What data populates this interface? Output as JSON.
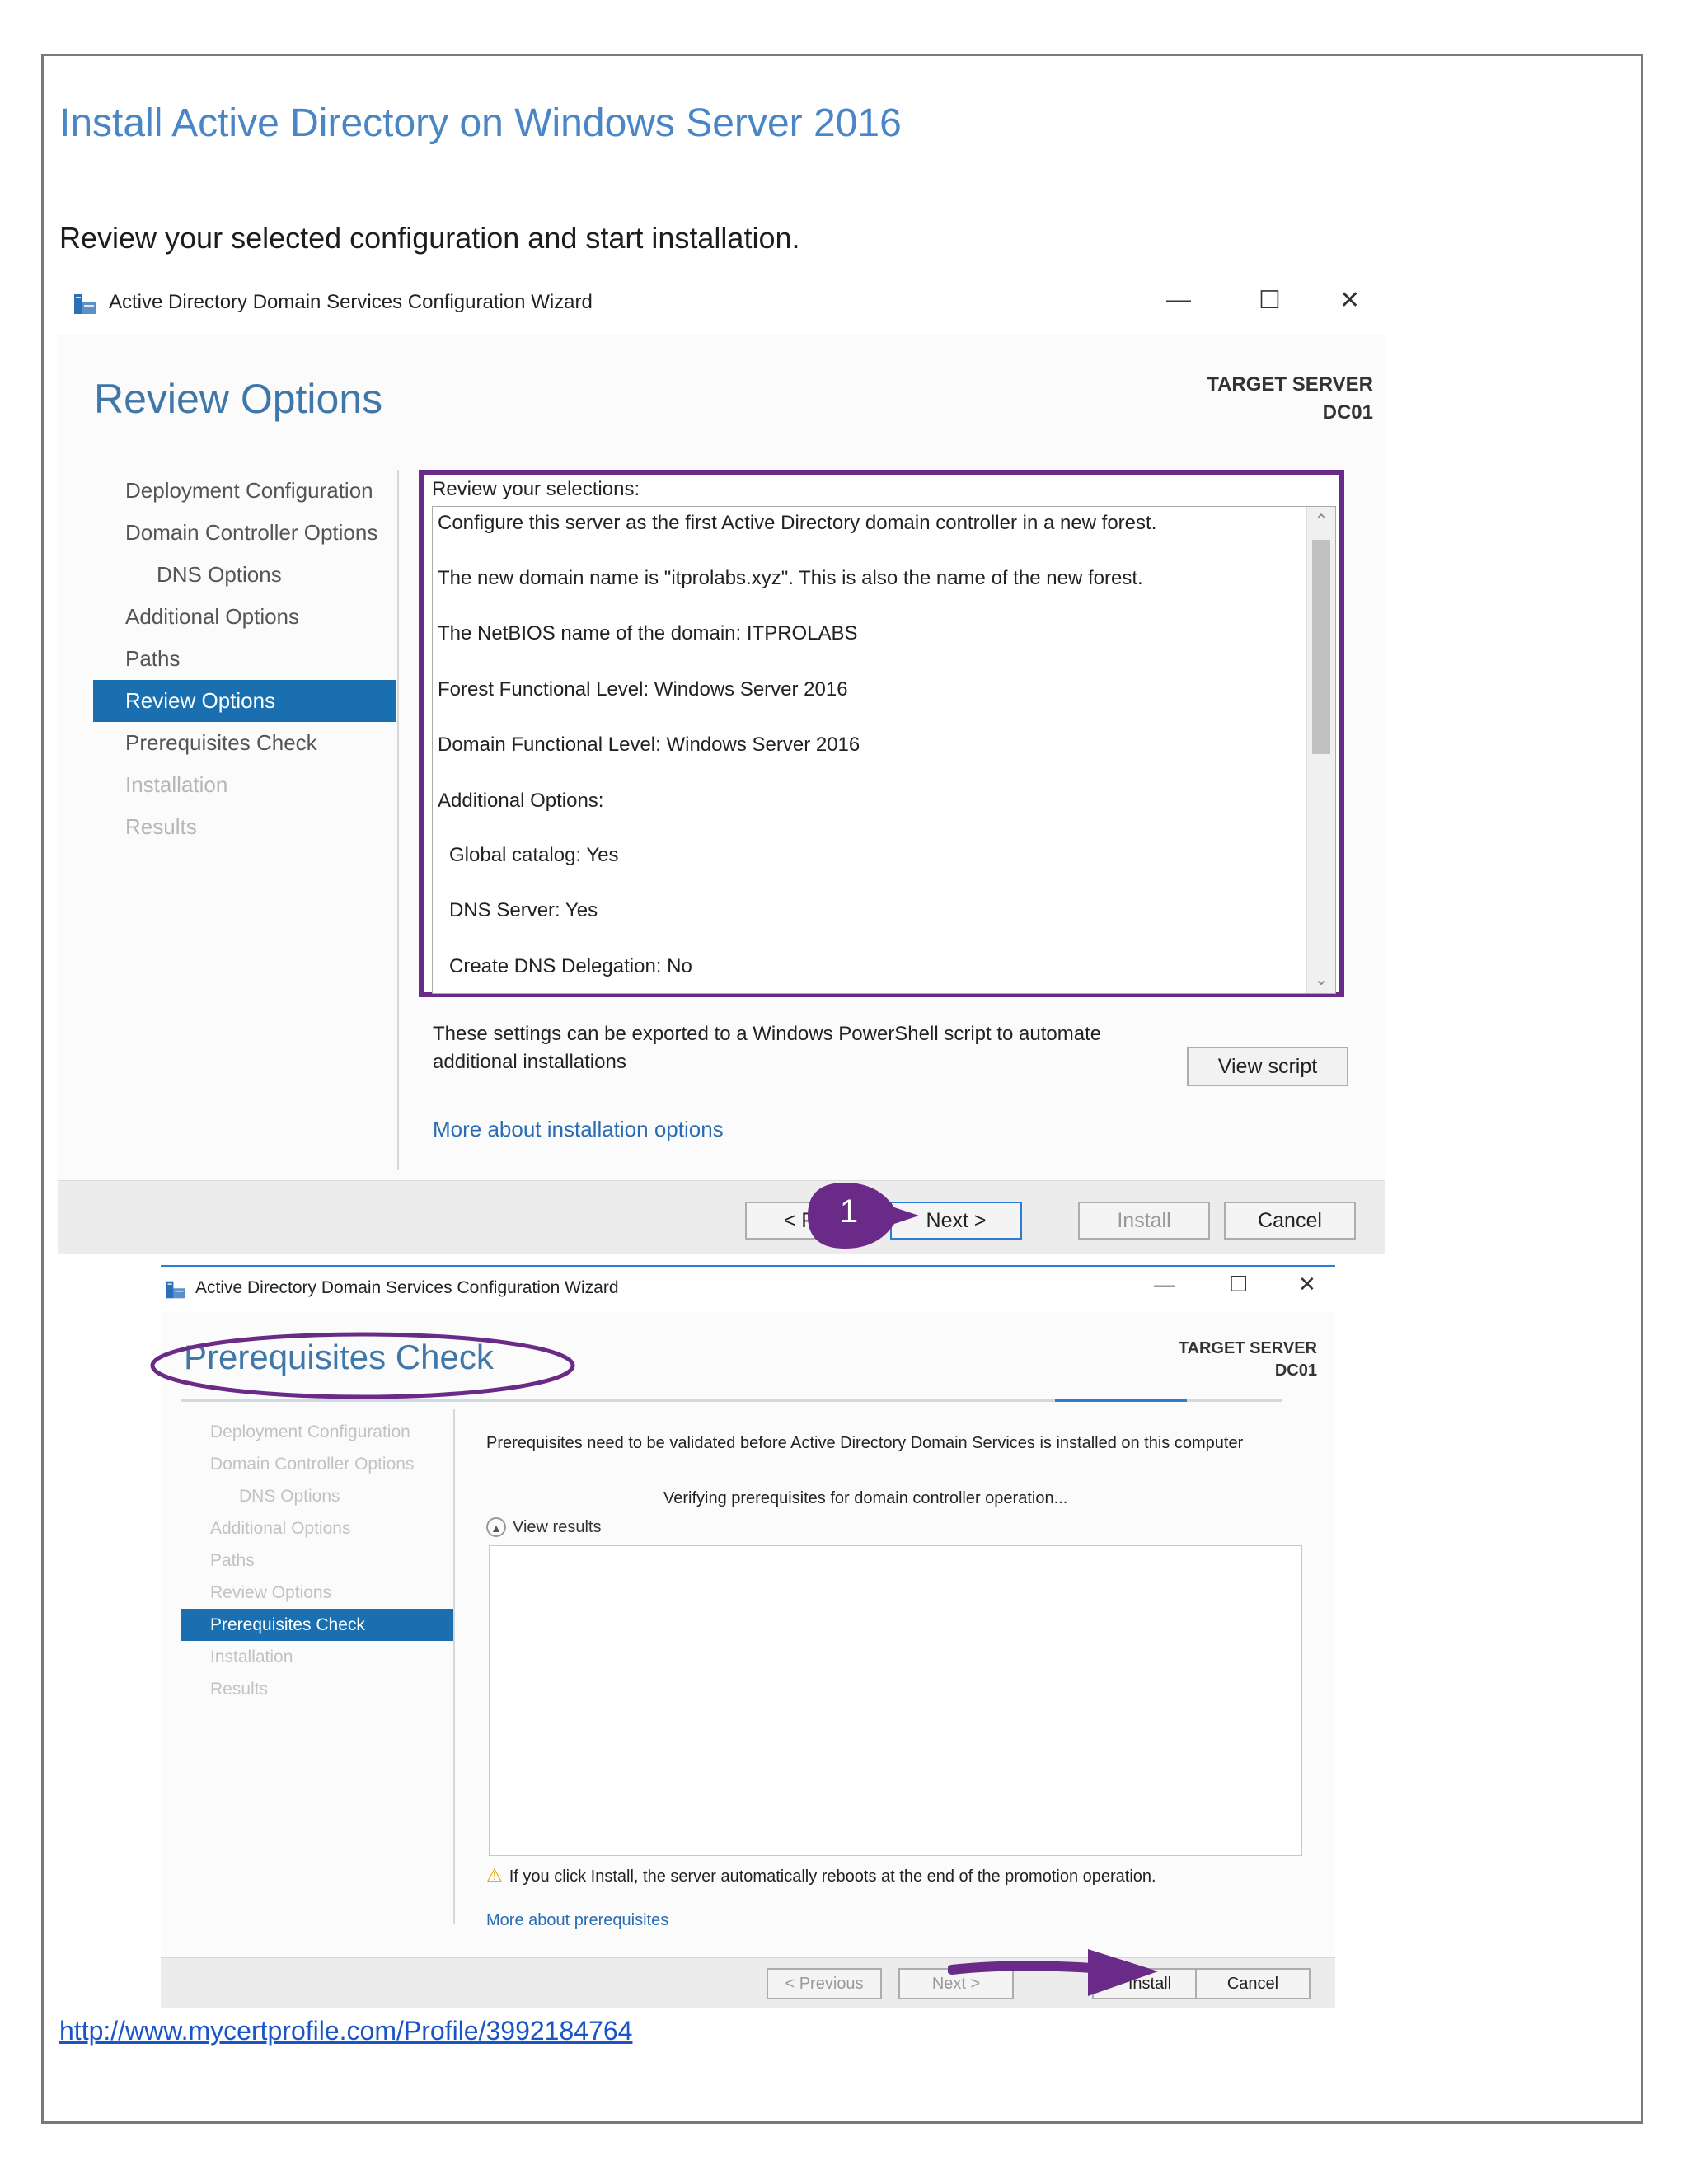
{
  "document": {
    "title": "Install Active Directory on Windows Server 2016",
    "subtitle": "Review your selected configuration and start installation.",
    "link": "http://www.mycertprofile.com/Profile/3992184764"
  },
  "window1": {
    "title": "Active Directory Domain Services Configuration Wizard",
    "controls": {
      "minimize": "—",
      "maximize": "☐",
      "close": "✕"
    },
    "heading": "Review Options",
    "target_label": "TARGET SERVER",
    "target_name": "DC01",
    "nav": [
      {
        "label": "Deployment Configuration",
        "state": "normal"
      },
      {
        "label": "Domain Controller Options",
        "state": "normal"
      },
      {
        "label": "DNS Options",
        "state": "sub"
      },
      {
        "label": "Additional Options",
        "state": "normal"
      },
      {
        "label": "Paths",
        "state": "normal"
      },
      {
        "label": "Review Options",
        "state": "active"
      },
      {
        "label": "Prerequisites Check",
        "state": "normal"
      },
      {
        "label": "Installation",
        "state": "disabled"
      },
      {
        "label": "Results",
        "state": "disabled"
      }
    ],
    "review_label": "Review your selections:",
    "review_lines": [
      "Configure this server as the first Active Directory domain controller in a new forest.",
      "The new domain name is \"itprolabs.xyz\". This is also the name of the new forest.",
      "The NetBIOS name of the domain: ITPROLABS",
      "Forest Functional Level: Windows Server 2016",
      "Domain Functional Level: Windows Server 2016",
      "Additional Options:",
      "Global catalog: Yes",
      "DNS Server: Yes",
      "Create DNS Delegation: No"
    ],
    "export_text": "These settings can be exported to a Windows PowerShell script to automate additional installations",
    "view_script": "View script",
    "more_link": "More about installation options",
    "buttons": {
      "previous": "< Pr",
      "next": "Next >",
      "install": "Install",
      "cancel": "Cancel"
    },
    "callout_number": "1"
  },
  "window2": {
    "title": "Active Directory Domain Services Configuration Wizard",
    "controls": {
      "minimize": "—",
      "maximize": "☐",
      "close": "✕"
    },
    "heading": "Prerequisites Check",
    "target_label": "TARGET SERVER",
    "target_name": "DC01",
    "nav": [
      {
        "label": "Deployment Configuration",
        "state": "disabled"
      },
      {
        "label": "Domain Controller Options",
        "state": "disabled"
      },
      {
        "label": "DNS Options",
        "state": "sub"
      },
      {
        "label": "Additional Options",
        "state": "disabled"
      },
      {
        "label": "Paths",
        "state": "disabled"
      },
      {
        "label": "Review Options",
        "state": "disabled"
      },
      {
        "label": "Prerequisites Check",
        "state": "active"
      },
      {
        "label": "Installation",
        "state": "disabled"
      },
      {
        "label": "Results",
        "state": "disabled"
      }
    ],
    "description": "Prerequisites need to be validated before Active Directory Domain Services is installed on this computer",
    "verifying": "Verifying prerequisites for domain controller operation...",
    "view_results": "View results",
    "warning": "If you click Install, the server automatically reboots at the end of the promotion operation.",
    "more_link": "More about prerequisites",
    "buttons": {
      "previous": "< Previous",
      "next": "Next >",
      "install": "Install",
      "cancel": "Cancel"
    }
  },
  "colors": {
    "accent": "#1a6fb0",
    "annotation_purple": "#6a2b88",
    "title_blue": "#4a86c5",
    "link_blue": "#1a55c8"
  }
}
